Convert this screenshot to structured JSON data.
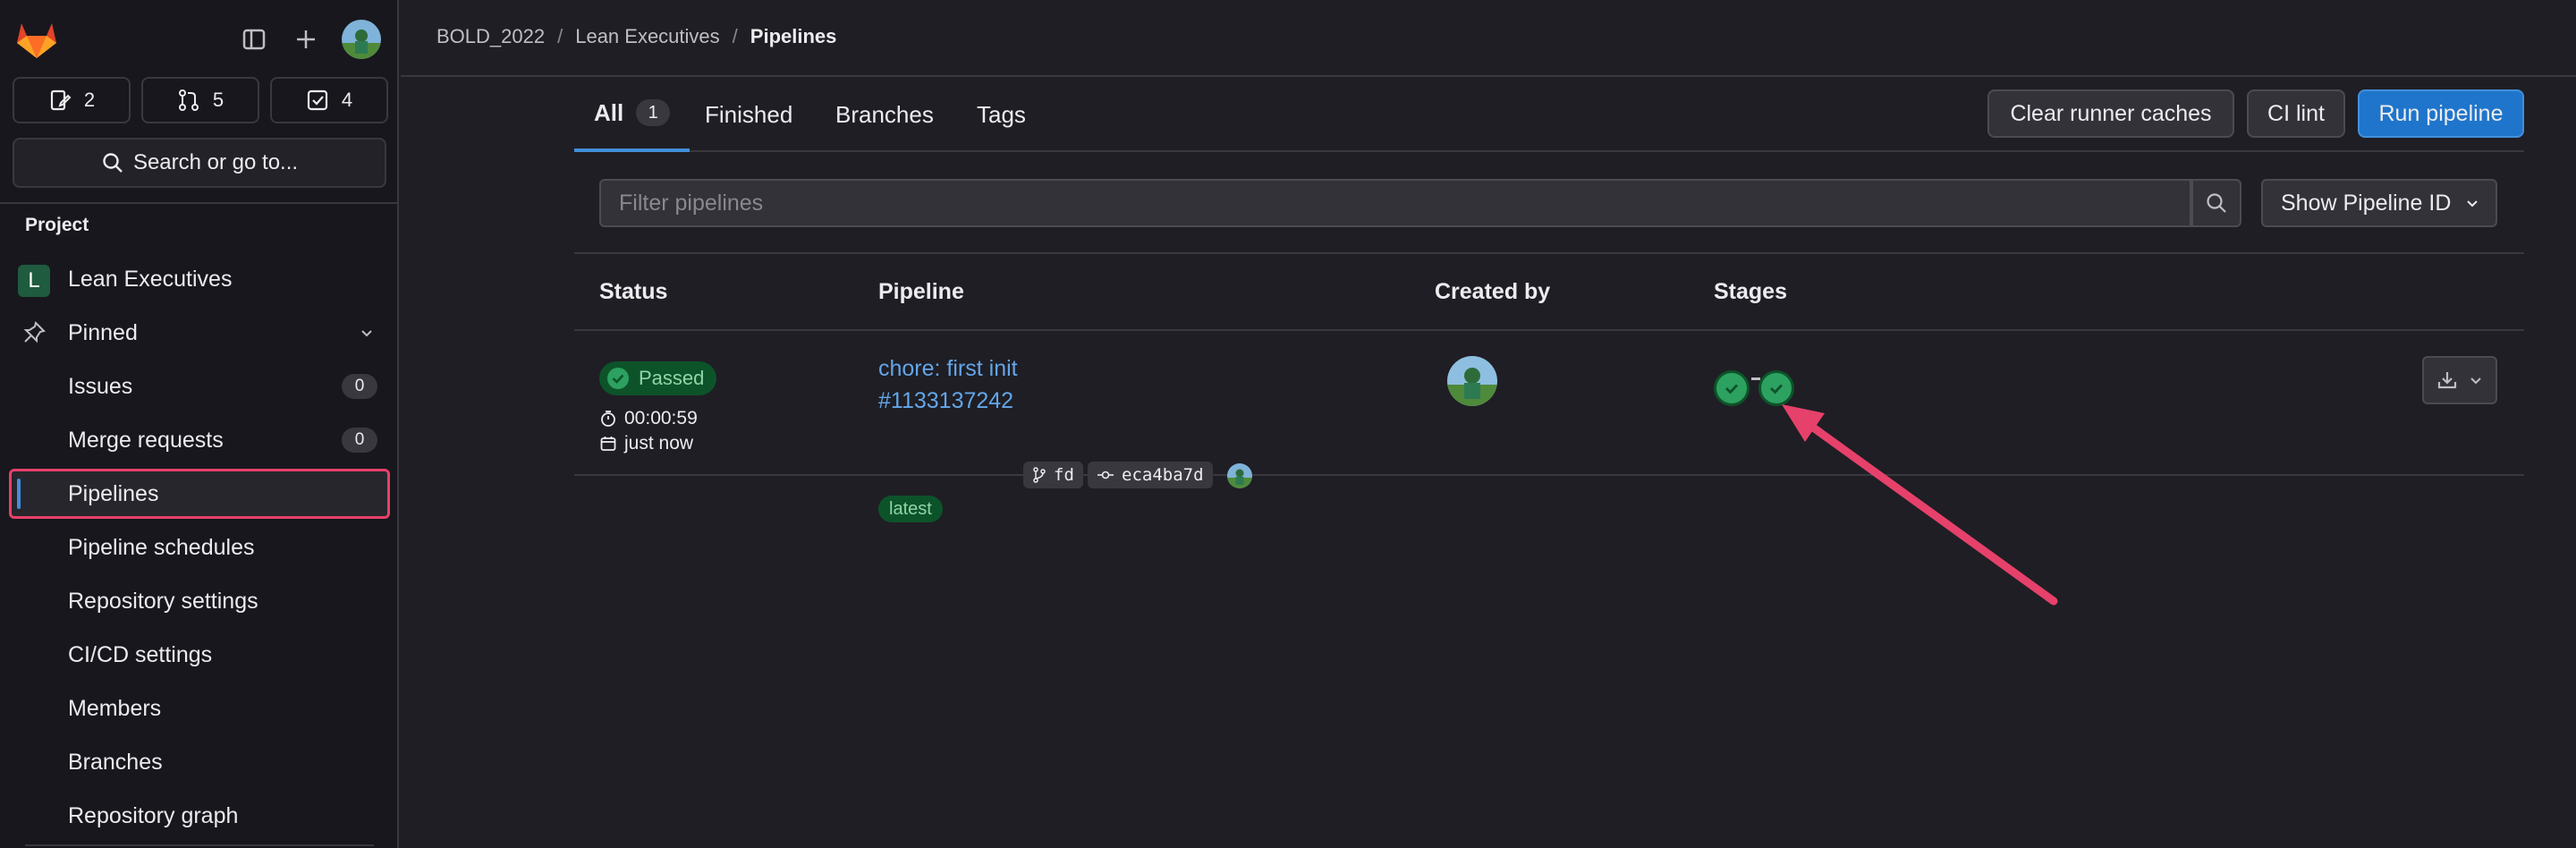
{
  "sidebar": {
    "counts": [
      {
        "icon": "issues-icon",
        "value": "2"
      },
      {
        "icon": "merge-request-icon",
        "value": "5"
      },
      {
        "icon": "todo-icon",
        "value": "4"
      }
    ],
    "search_label": "Search or go to...",
    "section_label": "Project",
    "project": {
      "initial": "L",
      "name": "Lean Executives"
    },
    "pinned_label": "Pinned",
    "items": [
      {
        "label": "Issues",
        "badge": "0"
      },
      {
        "label": "Merge requests",
        "badge": "0"
      },
      {
        "label": "Pipelines"
      },
      {
        "label": "Pipeline schedules"
      },
      {
        "label": "Repository settings"
      },
      {
        "label": "CI/CD settings"
      },
      {
        "label": "Members"
      },
      {
        "label": "Branches"
      },
      {
        "label": "Repository graph"
      }
    ]
  },
  "breadcrumb": [
    "BOLD_2022",
    "Lean Executives",
    "Pipelines"
  ],
  "tabs": [
    {
      "label": "All",
      "count": "1"
    },
    {
      "label": "Finished"
    },
    {
      "label": "Branches"
    },
    {
      "label": "Tags"
    }
  ],
  "actions": {
    "clear_caches": "Clear runner caches",
    "ci_lint": "CI lint",
    "run_pipeline": "Run pipeline"
  },
  "filter": {
    "placeholder": "Filter pipelines",
    "dropdown": "Show Pipeline ID"
  },
  "table": {
    "headers": [
      "Status",
      "Pipeline",
      "Created by",
      "Stages"
    ],
    "rows": [
      {
        "status": "Passed",
        "duration": "00:00:59",
        "finished": "just now",
        "title": "chore: first init",
        "id": "#1133137242",
        "branch": "fd",
        "commit": "eca4ba7d",
        "tag": "latest",
        "stages": [
          "passed",
          "passed"
        ]
      }
    ]
  },
  "colors": {
    "accent": "#428fdc",
    "success": "#2da160",
    "annotation_arrow": "#e6416b"
  }
}
